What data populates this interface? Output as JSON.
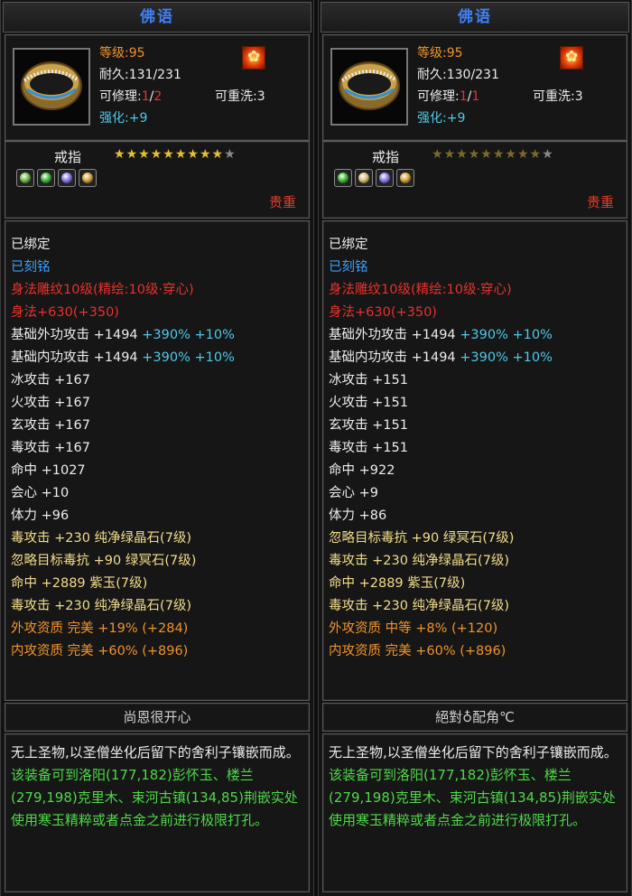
{
  "cards": [
    {
      "title": "佛语",
      "level_label": "等级",
      "level_value": ":95",
      "durability": "耐久:131/231",
      "repair_label": "可修理:",
      "repair_cur": "1",
      "repair_sep": "/",
      "repair_max": "2",
      "rewash": "可重洗:3",
      "enhance_label": "强化:",
      "enhance_value": "+9",
      "fire_icon": "fire-sigil",
      "type_name": "戒指",
      "stars_on": 9,
      "stars_total": 10,
      "gems": [
        "#6fbf4a",
        "#3fbf3a",
        "#8a7cf0",
        "#d8a23a"
      ],
      "rarity": "贵重",
      "attributes": [
        {
          "text": "已绑定",
          "color": "white"
        },
        {
          "text": "已刻铭",
          "color": "blue"
        },
        {
          "text": "身法雕纹10级(精绘:10级·穿心)",
          "color": "red"
        },
        {
          "text": "身法+630(+350)",
          "color": "red"
        },
        {
          "text": "基础外功攻击 +1494",
          "color": "white",
          "extra": " +390% +10%"
        },
        {
          "text": "基础内功攻击 +1494",
          "color": "white",
          "extra": " +390% +10%"
        },
        {
          "text": "冰攻击 +167",
          "color": "white"
        },
        {
          "text": "火攻击 +167",
          "color": "white"
        },
        {
          "text": "玄攻击 +167",
          "color": "white"
        },
        {
          "text": "毒攻击 +167",
          "color": "white"
        },
        {
          "text": "命中 +1027",
          "color": "white"
        },
        {
          "text": "会心 +10",
          "color": "white"
        },
        {
          "text": "体力 +96",
          "color": "white"
        },
        {
          "text": "毒攻击 +230 纯净绿晶石(7级)",
          "color": "gold"
        },
        {
          "text": "忽略目标毒抗 +90 绿冥石(7级)",
          "color": "gold"
        },
        {
          "text": "命中 +2889 紫玉(7级)",
          "color": "gold"
        },
        {
          "text": "毒攻击 +230 纯净绿晶石(7级)",
          "color": "gold"
        },
        {
          "text": "外攻资质  完美 +19% (+284)",
          "color": "orange"
        },
        {
          "text": "内攻资质  完美 +60% (+896)",
          "color": "orange"
        }
      ],
      "owner_note": "尚恩很开心",
      "desc_white": "无上圣物,以圣僧坐化后留下的舍利子镶嵌而成。",
      "desc_green": "该装备可到洛阳(177,182)彭怀玉、楼兰(279,198)克里木、束河古镇(134,85)荆嵌实处使用寒玉精粹或者点金之前进行极限打孔。"
    },
    {
      "title": "佛语",
      "level_label": "等级",
      "level_value": ":95",
      "durability": "耐久:130/231",
      "repair_label": "可修理:",
      "repair_cur": "1",
      "repair_sep": "/",
      "repair_max": "1",
      "rewash": "可重洗:3",
      "enhance_label": "强化:",
      "enhance_value": "+9",
      "fire_icon": "fire-sigil",
      "type_name": "戒指",
      "stars_on": 9,
      "stars_total": 10,
      "gems": [
        "#3fbf3a",
        "#d8c07a",
        "#8a7cf0",
        "#d8a23a"
      ],
      "rarity": "贵重",
      "attributes": [
        {
          "text": "已绑定",
          "color": "white"
        },
        {
          "text": "已刻铭",
          "color": "blue"
        },
        {
          "text": "身法雕纹10级(精绘:10级·穿心)",
          "color": "red"
        },
        {
          "text": "身法+630(+350)",
          "color": "red"
        },
        {
          "text": "基础外功攻击 +1494",
          "color": "white",
          "extra": " +390% +10%"
        },
        {
          "text": "基础内功攻击 +1494",
          "color": "white",
          "extra": " +390% +10%"
        },
        {
          "text": "冰攻击 +151",
          "color": "white"
        },
        {
          "text": "火攻击 +151",
          "color": "white"
        },
        {
          "text": "玄攻击 +151",
          "color": "white"
        },
        {
          "text": "毒攻击 +151",
          "color": "white"
        },
        {
          "text": "命中 +922",
          "color": "white"
        },
        {
          "text": "会心 +9",
          "color": "white"
        },
        {
          "text": "体力 +86",
          "color": "white"
        },
        {
          "text": "忽略目标毒抗 +90 绿冥石(7级)",
          "color": "gold"
        },
        {
          "text": "毒攻击 +230 纯净绿晶石(7级)",
          "color": "gold"
        },
        {
          "text": "命中 +2889 紫玉(7级)",
          "color": "gold"
        },
        {
          "text": "毒攻击 +230 纯净绿晶石(7级)",
          "color": "gold"
        },
        {
          "text": "外攻资质  中等 +8% (+120)",
          "color": "orange"
        },
        {
          "text": "内攻资质  完美 +60% (+896)",
          "color": "orange"
        }
      ],
      "owner_note": "絕對♁配角℃",
      "desc_white": "无上圣物,以圣僧坐化后留下的舍利子镶嵌而成。",
      "desc_green": "该装备可到洛阳(177,182)彭怀玉、楼兰(279,198)克里木、束河古镇(134,85)荆嵌实处使用寒玉精粹或者点金之前进行极限打孔。"
    }
  ]
}
